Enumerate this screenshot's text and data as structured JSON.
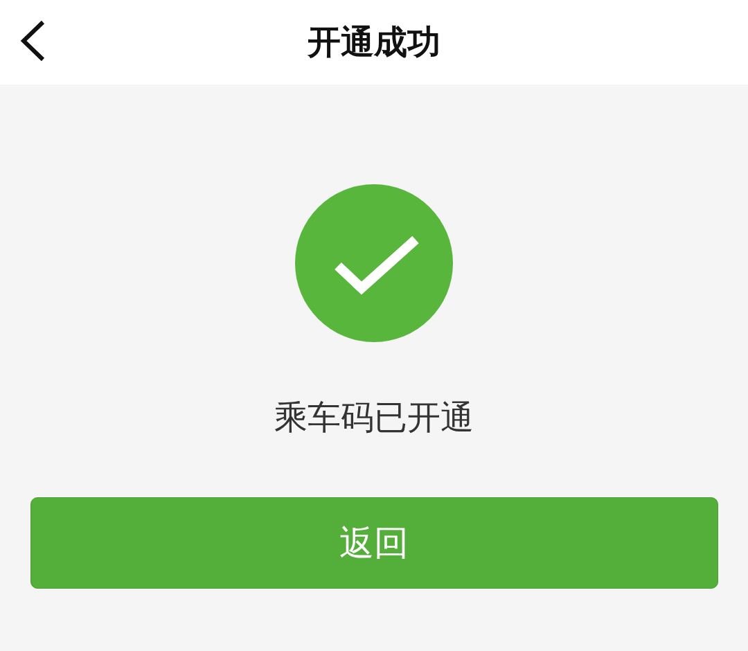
{
  "header": {
    "title": "开通成功"
  },
  "status": {
    "kind": "success",
    "message": "乘车码已开通"
  },
  "buttons": [
    {
      "label": "返回"
    }
  ]
}
